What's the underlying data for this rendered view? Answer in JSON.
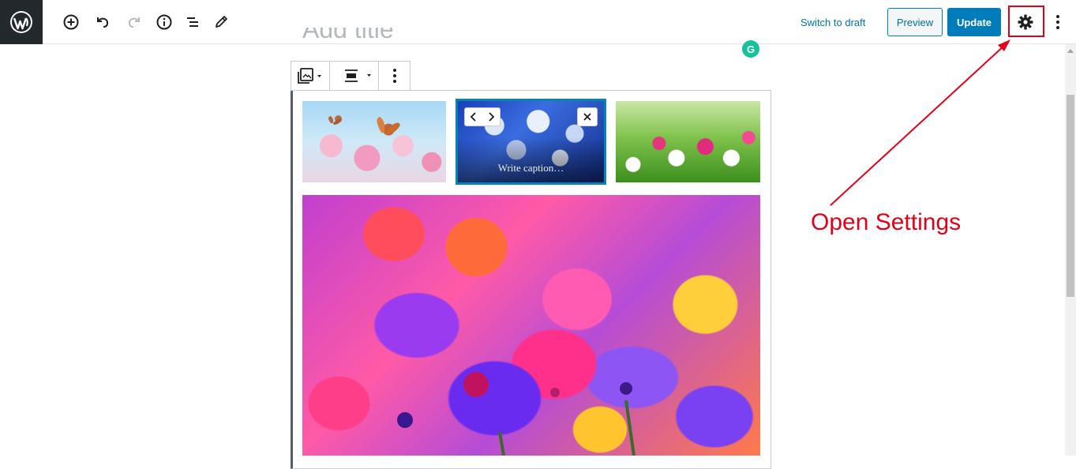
{
  "toolbar": {
    "switch_draft_label": "Switch to draft",
    "preview_label": "Preview",
    "update_label": "Update"
  },
  "editor": {
    "title_placeholder": "Add title",
    "grammarly_badge": "G",
    "gallery": {
      "caption_placeholder": "Write caption…"
    }
  },
  "annotation": {
    "text": "Open Settings",
    "color": "#e4001b"
  },
  "colors": {
    "accent": "#007cba",
    "wp_logo_bg": "#23282d",
    "selected_border": "#0085ba"
  }
}
